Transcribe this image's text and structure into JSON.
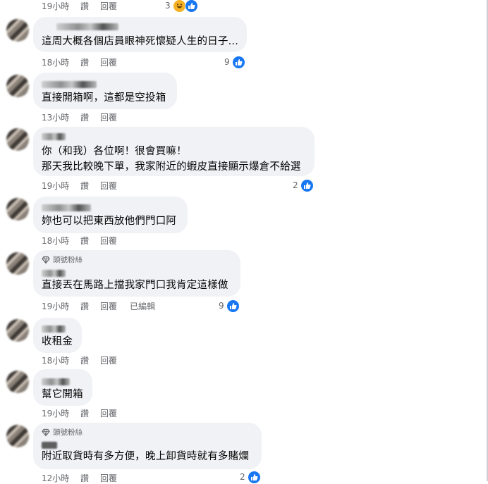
{
  "labels": {
    "like": "讚",
    "reply": "回覆",
    "edited": "已編輯",
    "fan_badge": "頭號粉絲"
  },
  "colors": {
    "bubble": "#f0f2f5",
    "meta": "#65676b",
    "like": "#1877f2",
    "haha": "#f7b125"
  },
  "comments": [
    {
      "time": "19小時",
      "reaction_count": "3",
      "reactions": [
        "like-icon",
        "haha-icon"
      ]
    },
    {
      "text": "這周大概各個店員眼神死懷疑人生的日子...",
      "time": "18小時",
      "reaction_count": "9"
    },
    {
      "text": "直接開箱啊，這都是空投箱",
      "time": "13小時"
    },
    {
      "text_lines": [
        "你（和我）各位啊！很會買嘛！",
        "那天我比較晚下單，我家附近的蝦皮直接顯示爆倉不給選"
      ],
      "time": "19小時",
      "reaction_count": "2"
    },
    {
      "text": "妳也可以把東西放他們門口阿",
      "time": "18小時"
    },
    {
      "badge": true,
      "text": "直接丟在馬路上擋我家門口我肯定這樣做",
      "time": "19小時",
      "edited": true,
      "reaction_count": "9"
    },
    {
      "text": "收租金",
      "time": "18小時"
    },
    {
      "text": "幫它開箱",
      "time": "19小時"
    },
    {
      "badge": true,
      "text": "附近取貨時有多方便，晚上卸貨時就有多賭爛",
      "time": "12小時",
      "reaction_count": "2"
    }
  ]
}
